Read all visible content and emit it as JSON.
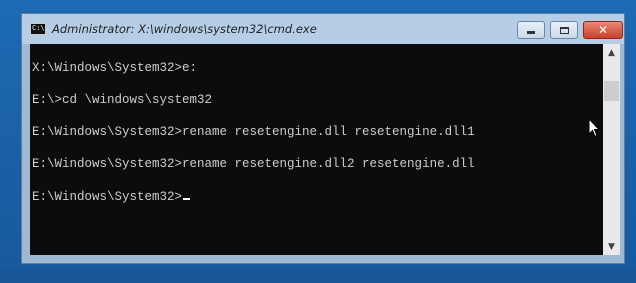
{
  "window": {
    "title": "Administrator: X:\\windows\\system32\\cmd.exe",
    "app_icon_text": "C:\\"
  },
  "controls": {
    "minimize": "minimize",
    "maximize": "maximize",
    "close": "✕"
  },
  "console": {
    "lines": [
      "X:\\Windows\\System32>e:",
      "E:\\>cd \\windows\\system32",
      "E:\\Windows\\System32>rename resetengine.dll resetengine.dll1",
      "E:\\Windows\\System32>rename resetengine.dll2 resetengine.dll",
      "E:\\Windows\\System32>"
    ],
    "text_color": "#cccccc",
    "background": "#0c0c0c"
  },
  "scrollbar": {
    "up_arrow": "▲",
    "down_arrow": "▼"
  },
  "icons": {
    "cursor": "mouse-pointer-icon"
  }
}
